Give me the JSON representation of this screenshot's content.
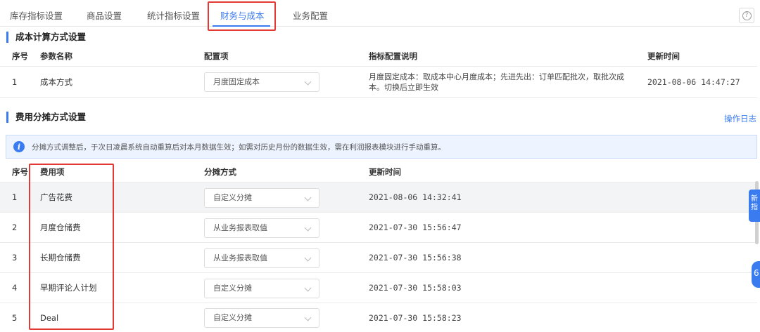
{
  "tabs": [
    {
      "label": "库存指标设置",
      "active": false
    },
    {
      "label": "商品设置",
      "active": false
    },
    {
      "label": "统计指标设置",
      "active": false
    },
    {
      "label": "财务与成本",
      "active": true
    },
    {
      "label": "业务配置",
      "active": false
    }
  ],
  "help_icon": "question-circle-icon",
  "cost_section": {
    "title": "成本计算方式设置",
    "headers": [
      "序号",
      "参数名称",
      "配置项",
      "指标配置说明",
      "更新时间"
    ],
    "rows": [
      {
        "index": "1",
        "name": "成本方式",
        "config": "月度固定成本",
        "description": "月度固定成本：取成本中心月度成本；先进先出：订单匹配批次，取批次成本。切换后立即生效",
        "updated": "2021-08-06 14:47:27"
      }
    ]
  },
  "allocation_section": {
    "title": "费用分摊方式设置",
    "ops_link": "操作日志",
    "info": "分摊方式调整后，于次日凌晨系统自动重算后对本月数据生效；如需对历史月份的数据生效，需在利润报表模块进行手动重算。",
    "info_icon": "info-circle-icon",
    "headers": [
      "序号",
      "费用项",
      "分摊方式",
      "更新时间"
    ],
    "rows": [
      {
        "index": "1",
        "item": "广告花费",
        "method": "自定义分摊",
        "updated": "2021-08-06 14:32:41"
      },
      {
        "index": "2",
        "item": "月度仓储费",
        "method": "从业务报表取值",
        "updated": "2021-07-30 15:56:47"
      },
      {
        "index": "3",
        "item": "长期仓储费",
        "method": "从业务报表取值",
        "updated": "2021-07-30 15:56:38"
      },
      {
        "index": "4",
        "item": "早期评论人计划",
        "method": "自定义分摊",
        "updated": "2021-07-30 15:58:03"
      },
      {
        "index": "5",
        "item": "Deal",
        "method": "自定义分摊",
        "updated": "2021-07-30 15:58:23"
      }
    ]
  },
  "float_buttons": {
    "new_label": "新指",
    "round_label": "6"
  },
  "colors": {
    "accent": "#3a7bef",
    "highlight": "#e53935",
    "info_bg": "#edf3ff"
  }
}
